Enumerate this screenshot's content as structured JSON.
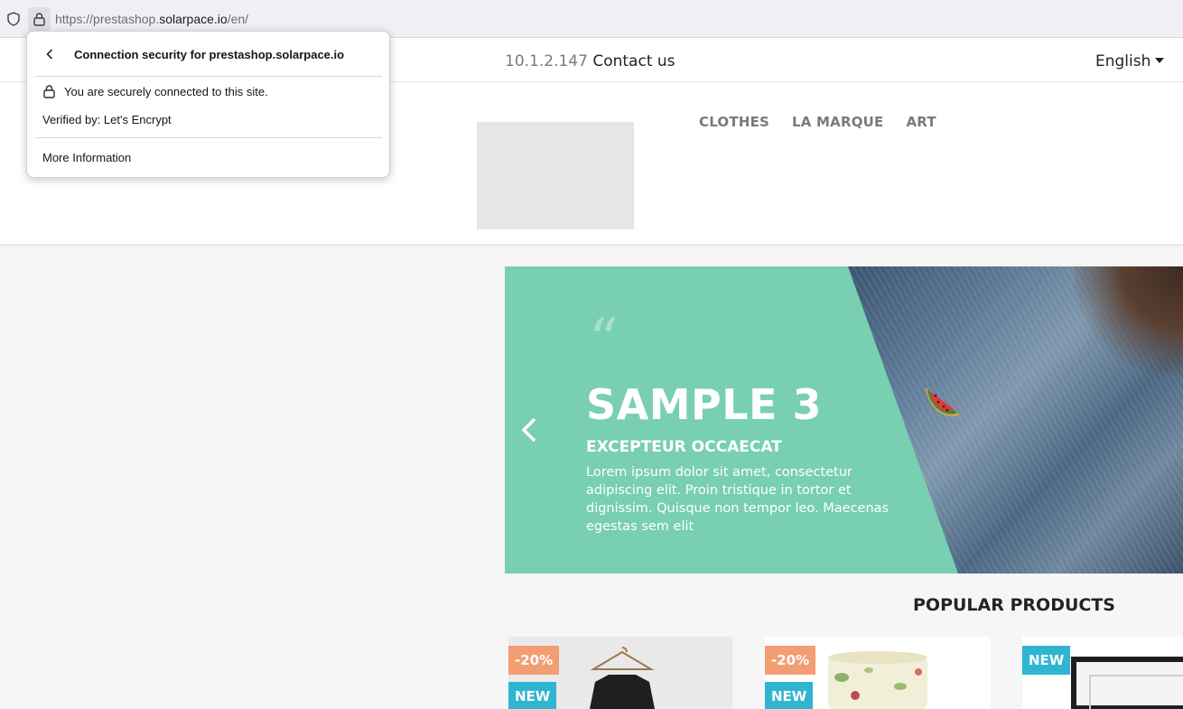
{
  "browser": {
    "url_prefix": "https://",
    "url_host_dim": "prestashop.",
    "url_host": "solarpace.io",
    "url_path": "/en/"
  },
  "popup": {
    "title": "Connection security for prestashop.solarpace.io",
    "secure_text": "You are securely connected to this site.",
    "verified_text": "Verified by: Let's Encrypt",
    "more_info": "More Information"
  },
  "topnav": {
    "ip": "10.1.2.147",
    "contact": "Contact us",
    "language": "English"
  },
  "menu": {
    "items": [
      "CLOTHES",
      "LA MARQUE",
      "ART"
    ]
  },
  "slider": {
    "quote_mark": "“",
    "title": "SAMPLE 3",
    "subtitle": "EXCEPTEUR OCCAECAT",
    "description": "Lorem ipsum dolor sit amet, consectetur adipiscing elit. Proin tristique in tortor et dignissim. Quisque non tempor leo. Maecenas egestas sem elit",
    "accent_color": "#78cfb2"
  },
  "popular": {
    "heading": "POPULAR PRODUCTS",
    "products": [
      {
        "discount": "-20%",
        "badge": "NEW"
      },
      {
        "discount": "-20%",
        "badge": "NEW"
      },
      {
        "badge": "NEW"
      }
    ]
  },
  "icons": [
    "shield-icon",
    "lock-icon",
    "back-arrow-icon",
    "chevron-left-icon"
  ]
}
